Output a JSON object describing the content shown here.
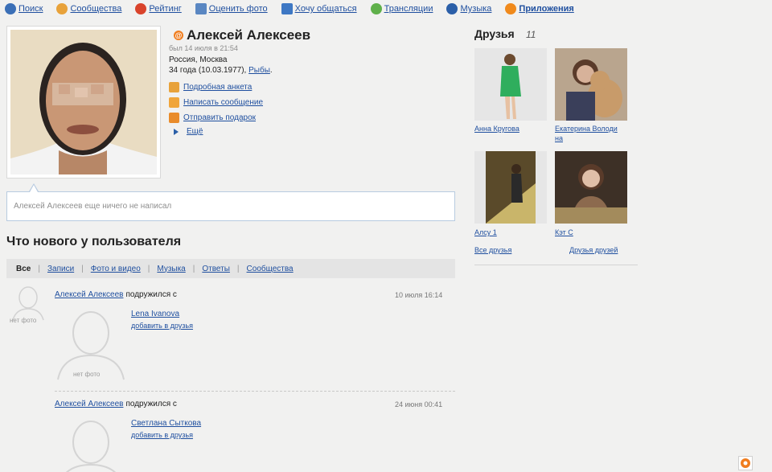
{
  "nav": [
    {
      "label": "Поиск",
      "icon": "search-icon",
      "color": "#3b6fb6"
    },
    {
      "label": "Сообщества",
      "icon": "community-icon",
      "color": "#e8a23a"
    },
    {
      "label": "Рейтинг",
      "icon": "rating-icon",
      "color": "#d9432b"
    },
    {
      "label": "Оценить фото",
      "icon": "rate-photo-icon",
      "color": "#5a87c2"
    },
    {
      "label": "Хочу общаться",
      "icon": "chat-icon",
      "color": "#3e78c4"
    },
    {
      "label": "Трансляции",
      "icon": "broadcast-icon",
      "color": "#5fb04a"
    },
    {
      "label": "Музыка",
      "icon": "music-icon",
      "color": "#2b5fa8"
    },
    {
      "label": "Приложения",
      "icon": "apps-icon",
      "color": "#f08a1c"
    }
  ],
  "profile": {
    "name": "Алексей Алексеев",
    "last_seen": "был 14 июля в 21:54",
    "location": "Россия, Москва",
    "age_text": "34 года (10.03.1977), ",
    "zodiac": "Рыбы",
    "actions": {
      "details": "Подробная анкета",
      "message": "Написать сообщение",
      "gift": "Отправить подарок",
      "more": "Ещё"
    },
    "status": "Алексей Алексеев еще ничего не написал"
  },
  "feed": {
    "title": "Что нового у пользователя",
    "tabs": [
      "Все",
      "Записи",
      "Фото и видео",
      "Музыка",
      "Ответы",
      "Сообщества"
    ],
    "items": [
      {
        "actor": "Алексей Алексеев",
        "verb": "подружился с",
        "time": "10 июля 16:14",
        "friend": "Lena Ivanova",
        "add": "добавить в друзья",
        "no_photo": "нет фото"
      },
      {
        "actor": "Алексей Алексеев",
        "verb": "подружился с",
        "time": "24 июня 00:41",
        "friend": "Светлана Сыткова",
        "add": "добавить в друзья",
        "no_photo": "нет фото"
      }
    ],
    "small_no_photo": "нет фото"
  },
  "friends": {
    "title": "Друзья",
    "count": "11",
    "people": [
      {
        "name": "Анна Кругова"
      },
      {
        "name": "Екатерина Володи"
      },
      {
        "name": "на"
      },
      {
        "name": "Алсу 1"
      },
      {
        "name": "Кэт С"
      }
    ],
    "all": "Все друзья",
    "friends_of_friends": "Друзья друзей"
  }
}
